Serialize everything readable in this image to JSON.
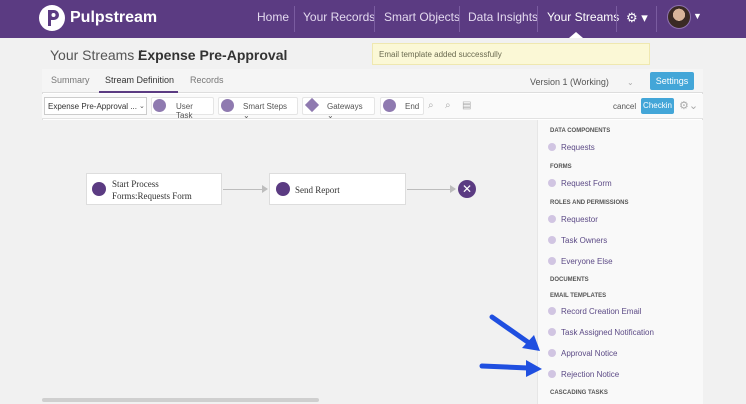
{
  "nav": {
    "brand": "Pulpstream",
    "items": [
      "Home",
      "Your Records",
      "Smart Objects",
      "Data Insights",
      "Your Streams"
    ]
  },
  "breadcrumb": {
    "root": "Your Streams /",
    "current": "Expense Pre-Approval"
  },
  "toast": "Email template added successfully",
  "tabs": [
    "Summary",
    "Stream Definition",
    "Records"
  ],
  "version": "Version 1 (Working)",
  "settings_label": "Settings",
  "toolbar": {
    "selector": "Expense Pre-Approval ...",
    "user_task": "User Task",
    "smart_steps": "Smart Steps",
    "gateways": "Gateways",
    "end": "End",
    "cancel": "cancel",
    "checkin": "Checkin"
  },
  "flow": {
    "start_line1": "Start Process",
    "start_line2": "Forms:Requests Form",
    "send_report": "Send Report"
  },
  "panel": {
    "data_components": "DATA COMPONENTS",
    "requests": "Requests",
    "forms": "FORMS",
    "request_form": "Request Form",
    "roles": "ROLES AND PERMISSIONS",
    "requestor": "Requestor",
    "task_owners": "Task Owners",
    "everyone_else": "Everyone Else",
    "documents": "DOCUMENTS",
    "email_templates": "EMAIL TEMPLATES",
    "record_creation_email": "Record Creation Email",
    "task_assigned": "Task Assigned Notification",
    "approval_notice": "Approval Notice",
    "rejection_notice": "Rejection Notice",
    "cascading_tasks": "CASCADING TASKS"
  },
  "colors": {
    "nav": "#5b3b82",
    "accent": "#43a6d8",
    "arrow": "#1f4fe0"
  },
  "icons": [
    "pulpstream-logo-icon",
    "gear-icon",
    "user-task-icon",
    "smart-steps-icon",
    "gateways-icon",
    "end-icon",
    "zoom-in-icon",
    "zoom-out-icon",
    "print-icon",
    "form-icon",
    "email-icon",
    "close-icon"
  ]
}
